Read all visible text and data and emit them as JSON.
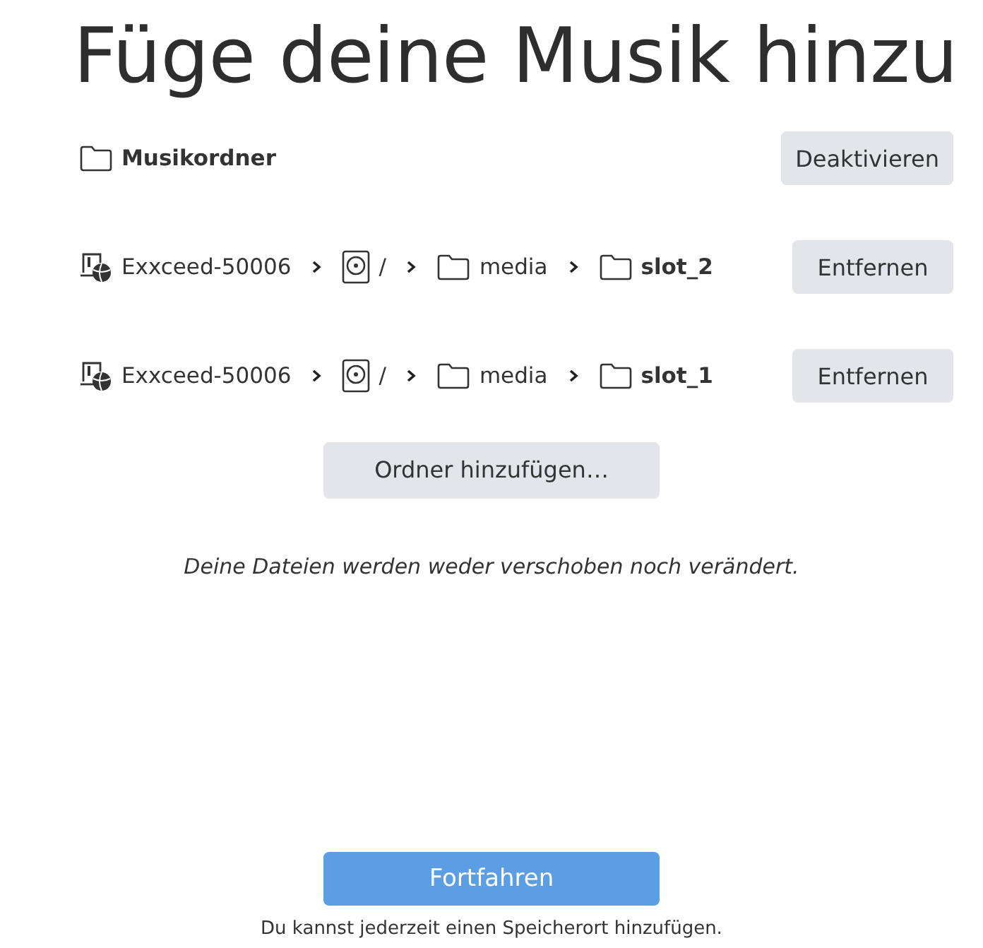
{
  "title": "Füge deine Musik hinzu",
  "locations": [
    {
      "path": [
        {
          "kind": "folder",
          "label": "Musikordner",
          "bold": true
        }
      ],
      "button": "Deaktivieren"
    },
    {
      "path": [
        {
          "kind": "host",
          "label": "Exxceed-50006",
          "bold": false
        },
        {
          "kind": "drive",
          "label": "/",
          "bold": false
        },
        {
          "kind": "folder",
          "label": "media",
          "bold": false
        },
        {
          "kind": "folder",
          "label": "slot_2",
          "bold": true
        }
      ],
      "button": "Entfernen"
    },
    {
      "path": [
        {
          "kind": "host",
          "label": "Exxceed-50006",
          "bold": false
        },
        {
          "kind": "drive",
          "label": "/",
          "bold": false
        },
        {
          "kind": "folder",
          "label": "media",
          "bold": false
        },
        {
          "kind": "folder",
          "label": "slot_1",
          "bold": true
        }
      ],
      "button": "Entfernen"
    }
  ],
  "add_button": "Ordner hinzufügen…",
  "note": "Deine Dateien werden weder verschoben noch verändert.",
  "continue_button": "Fortfahren",
  "footer": "Du kannst jederzeit einen Speicherort hinzufügen."
}
